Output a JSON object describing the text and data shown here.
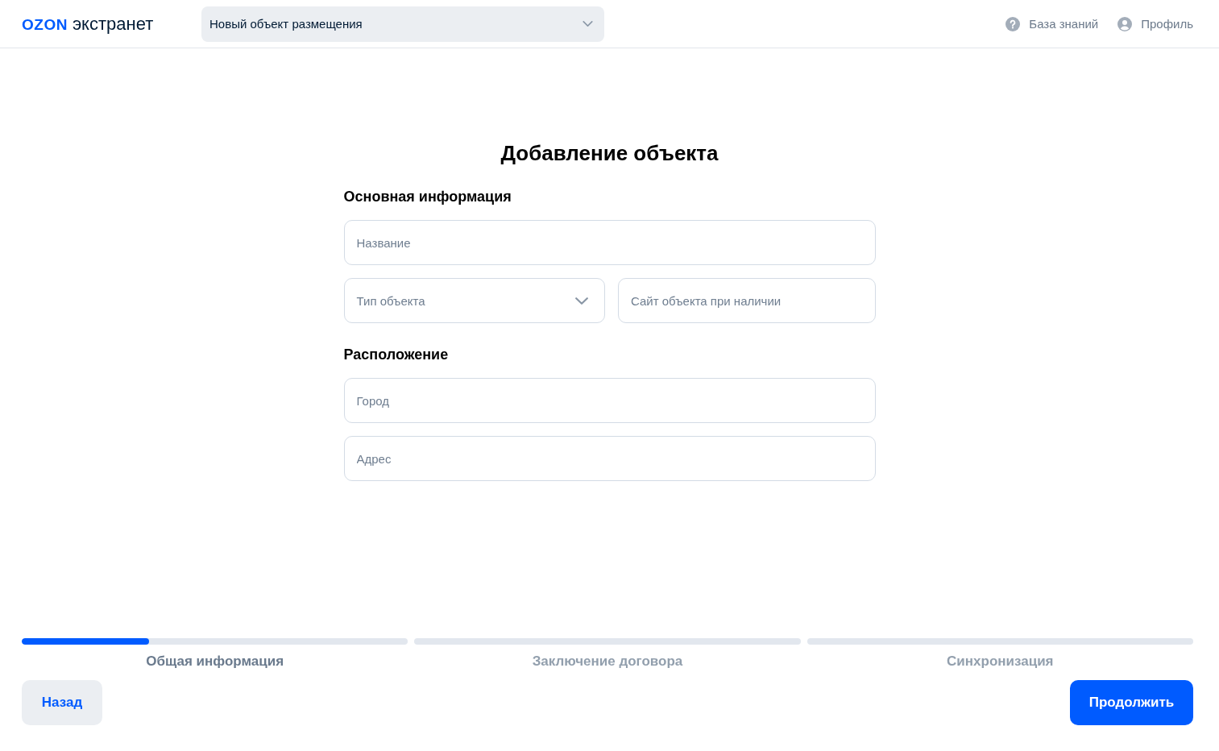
{
  "header": {
    "logo": {
      "brand": "OZON",
      "product": "экстранет"
    },
    "property_select": {
      "value": "Новый объект размещения"
    },
    "links": [
      {
        "kind": "help",
        "label": "База знаний"
      },
      {
        "kind": "profile",
        "label": "Профиль"
      }
    ]
  },
  "title": "Добавление объекта",
  "sections": [
    {
      "title": "Основная информация",
      "rows": [
        [
          {
            "kind": "text",
            "placeholder": "Название"
          }
        ],
        [
          {
            "kind": "select",
            "placeholder": "Тип объекта"
          },
          {
            "kind": "text",
            "placeholder": "Сайт объекта при наличии"
          }
        ]
      ]
    },
    {
      "title": "Расположение",
      "rows": [
        [
          {
            "kind": "text",
            "placeholder": "Город"
          }
        ],
        [
          {
            "kind": "text",
            "placeholder": "Адрес"
          }
        ]
      ]
    }
  ],
  "steps": [
    {
      "label": "Общая информация",
      "selected": true,
      "level": 0.33
    },
    {
      "label": "Заключение договора",
      "selected": false
    },
    {
      "label": "Синхронизация",
      "selected": false
    }
  ],
  "buttons": [
    {
      "kind": "secondary",
      "label": "Назад"
    },
    {
      "kind": "primary",
      "label": "Продолжить"
    }
  ]
}
